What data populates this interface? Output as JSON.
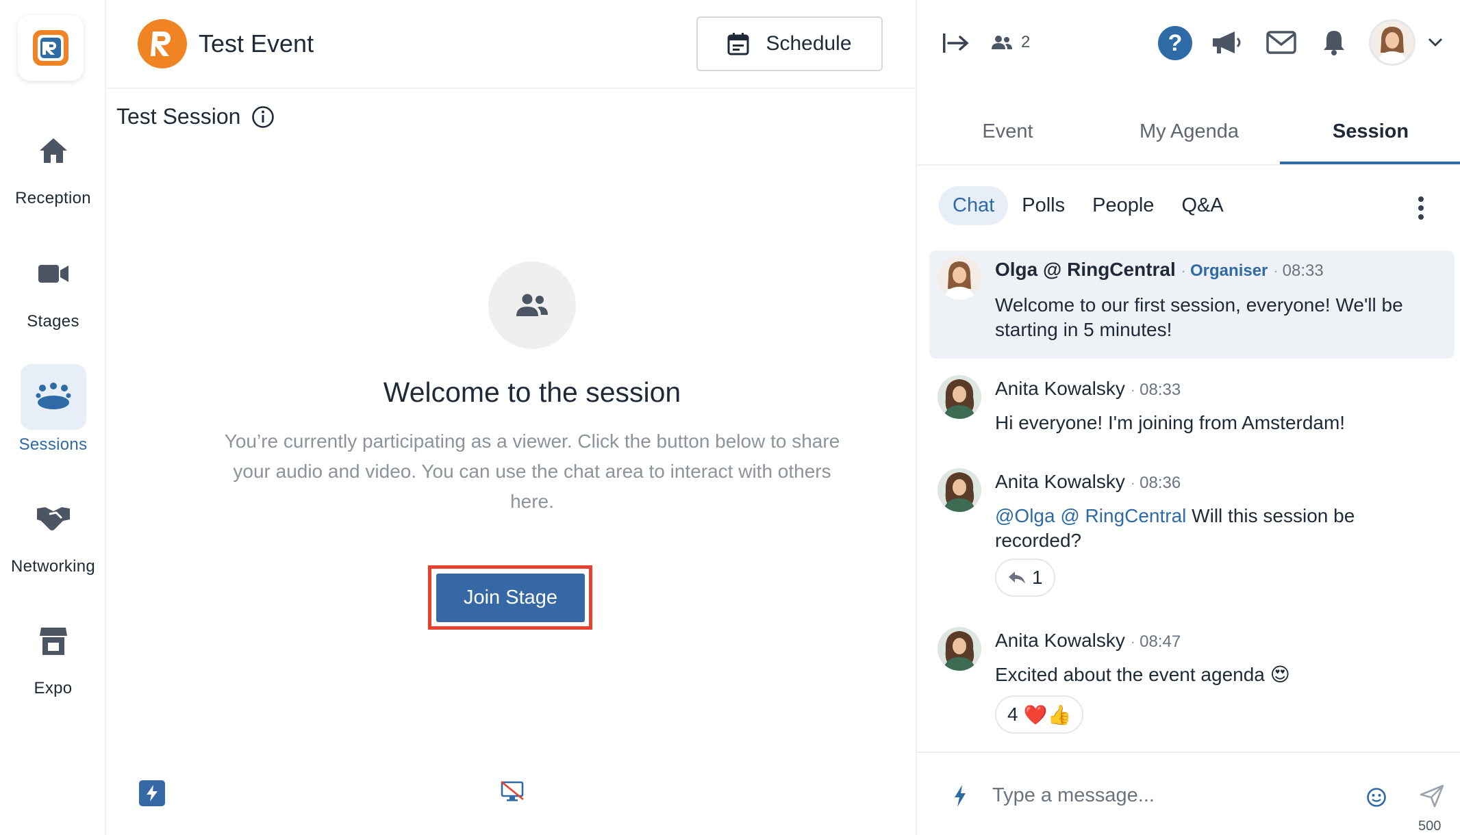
{
  "nav": {
    "items": [
      {
        "label": "Reception",
        "icon": "home-icon"
      },
      {
        "label": "Stages",
        "icon": "video-camera-icon"
      },
      {
        "label": "Sessions",
        "icon": "sessions-group-icon",
        "active": true
      },
      {
        "label": "Networking",
        "icon": "handshake-icon"
      },
      {
        "label": "Expo",
        "icon": "booth-icon"
      }
    ]
  },
  "header": {
    "event_title": "Test Event",
    "schedule_label": "Schedule"
  },
  "session": {
    "title": "Test Session",
    "welcome_heading": "Welcome to the session",
    "welcome_text": "You’re currently participating as a viewer. Click the button below to share your audio and video. You can use the chat area to interact with others here.",
    "join_label": "Join Stage"
  },
  "right_top": {
    "people_count": "2"
  },
  "tabs": [
    {
      "label": "Event"
    },
    {
      "label": "My Agenda"
    },
    {
      "label": "Session",
      "active": true
    }
  ],
  "subtabs": [
    {
      "label": "Chat",
      "active": true
    },
    {
      "label": "Polls"
    },
    {
      "label": "People"
    },
    {
      "label": "Q&A"
    }
  ],
  "messages": [
    {
      "name": "Olga @ RingCentral",
      "role": "Organiser",
      "time": "08:33",
      "text": "Welcome to our first session, everyone! We'll be starting in 5 minutes!",
      "pinned": true
    },
    {
      "name": "Anita Kowalsky",
      "time": "08:33",
      "text": "Hi everyone! I'm joining from Amsterdam!"
    },
    {
      "name": "Anita Kowalsky",
      "time": "08:36",
      "mention": "@Olga @ RingCentral",
      "text": " Will this session be recorded?",
      "reaction_count": "1"
    },
    {
      "name": "Anita Kowalsky",
      "time": "08:47",
      "text": "Excited about the event agenda 😍",
      "reaction_count": "4",
      "reaction_emojis": "❤️👍"
    }
  ],
  "composer": {
    "placeholder": "Type a message...",
    "char_limit": "500"
  },
  "colors": {
    "accent": "#2d6aa6",
    "join_button": "#3568a5",
    "highlight": "#e8412f",
    "logo_orange": "#f08323"
  }
}
